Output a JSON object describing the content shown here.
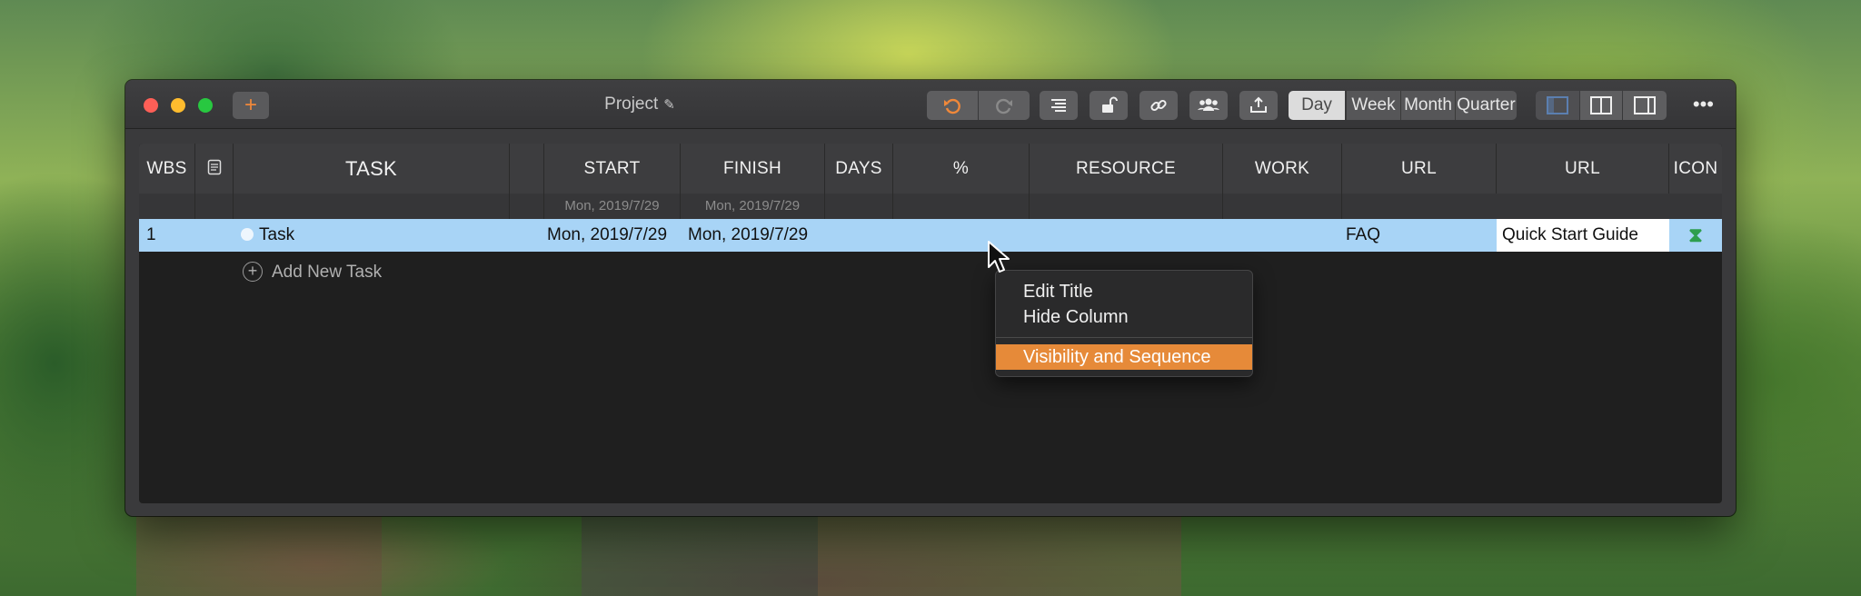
{
  "window": {
    "title": "Project",
    "pencil_icon": "✎",
    "add_label": "+",
    "more_label": "•••"
  },
  "toolbar": {
    "view_modes": [
      "Day",
      "Week",
      "Month",
      "Quarter"
    ],
    "active_view": "Day"
  },
  "table": {
    "columns": [
      "WBS",
      "",
      "TASK",
      "",
      "START",
      "FINISH",
      "DAYS",
      "%",
      "RESOURCE",
      "WORK",
      "URL",
      "URL",
      "ICON"
    ],
    "subheader": {
      "start": "Mon, 2019/7/29",
      "finish": "Mon, 2019/7/29"
    },
    "rows": [
      {
        "wbs": "1",
        "task": "Task",
        "start": "Mon, 2019/7/29",
        "finish": "Mon, 2019/7/29",
        "url1": "FAQ",
        "url2": "Quick Start Guide",
        "icon": "⧗"
      }
    ],
    "add_task_label": "Add New Task"
  },
  "context_menu": {
    "items": [
      "Edit Title",
      "Hide Column",
      "Visibility and Sequence"
    ],
    "selected": "Visibility and Sequence"
  },
  "colors": {
    "accent": "#f0883a",
    "row_highlight": "#a8d4f6",
    "menu_selected": "#e68a39",
    "icon_green": "#2e9e4e"
  }
}
